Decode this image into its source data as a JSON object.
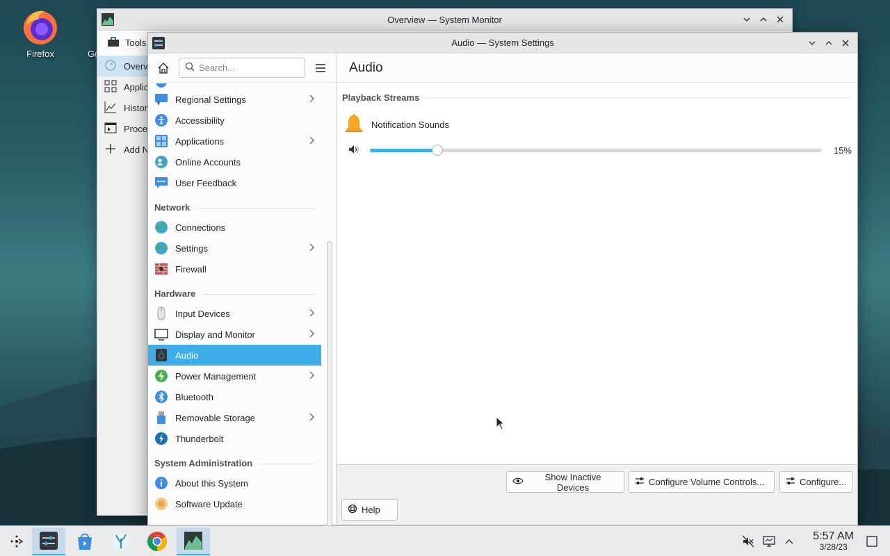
{
  "desktop": {
    "icons": [
      {
        "label": "Firefox"
      },
      {
        "label": "Go"
      }
    ]
  },
  "system_monitor": {
    "title": "Overview — System Monitor",
    "toolbar_label": "Tools",
    "sidebar": [
      {
        "label": "Overview",
        "icon": "speedometer-icon"
      },
      {
        "label": "Applications",
        "icon": "grid-icon"
      },
      {
        "label": "History",
        "icon": "chart-icon"
      },
      {
        "label": "Processes",
        "icon": "terminal-icon"
      },
      {
        "label": "Add New Page",
        "icon": "plus-icon"
      }
    ]
  },
  "settings": {
    "title": "Audio — System Settings",
    "search_placeholder": "Search...",
    "page_title": "Audio",
    "nav": {
      "top_items": [
        {
          "label": "Regional Settings",
          "has_children": true
        },
        {
          "label": "Accessibility"
        },
        {
          "label": "Applications",
          "has_children": true
        },
        {
          "label": "Online Accounts"
        },
        {
          "label": "User Feedback"
        }
      ],
      "network_header": "Network",
      "network_items": [
        {
          "label": "Connections"
        },
        {
          "label": "Settings",
          "has_children": true
        },
        {
          "label": "Firewall"
        }
      ],
      "hardware_header": "Hardware",
      "hardware_items": [
        {
          "label": "Input Devices",
          "has_children": true
        },
        {
          "label": "Display and Monitor",
          "has_children": true
        },
        {
          "label": "Audio",
          "selected": true
        },
        {
          "label": "Power Management",
          "has_children": true
        },
        {
          "label": "Bluetooth"
        },
        {
          "label": "Removable Storage",
          "has_children": true
        },
        {
          "label": "Thunderbolt"
        }
      ],
      "sysadmin_header": "System Administration",
      "sysadmin_items": [
        {
          "label": "About this System"
        },
        {
          "label": "Software Update"
        }
      ]
    },
    "audio": {
      "group_header": "Playback Streams",
      "stream_name": "Notification Sounds",
      "volume_percent": 15,
      "volume_label": "15%"
    },
    "buttons": {
      "show_inactive": "Show Inactive Devices",
      "configure_volume": "Configure Volume Controls...",
      "configure": "Configure...",
      "help": "Help"
    }
  },
  "taskbar": {
    "time": "5:57 AM",
    "date": "3/28/23"
  },
  "colors": {
    "accent": "#3daee9",
    "window_bg": "#fcfcfc",
    "titlebar": "#e3e5e7"
  }
}
